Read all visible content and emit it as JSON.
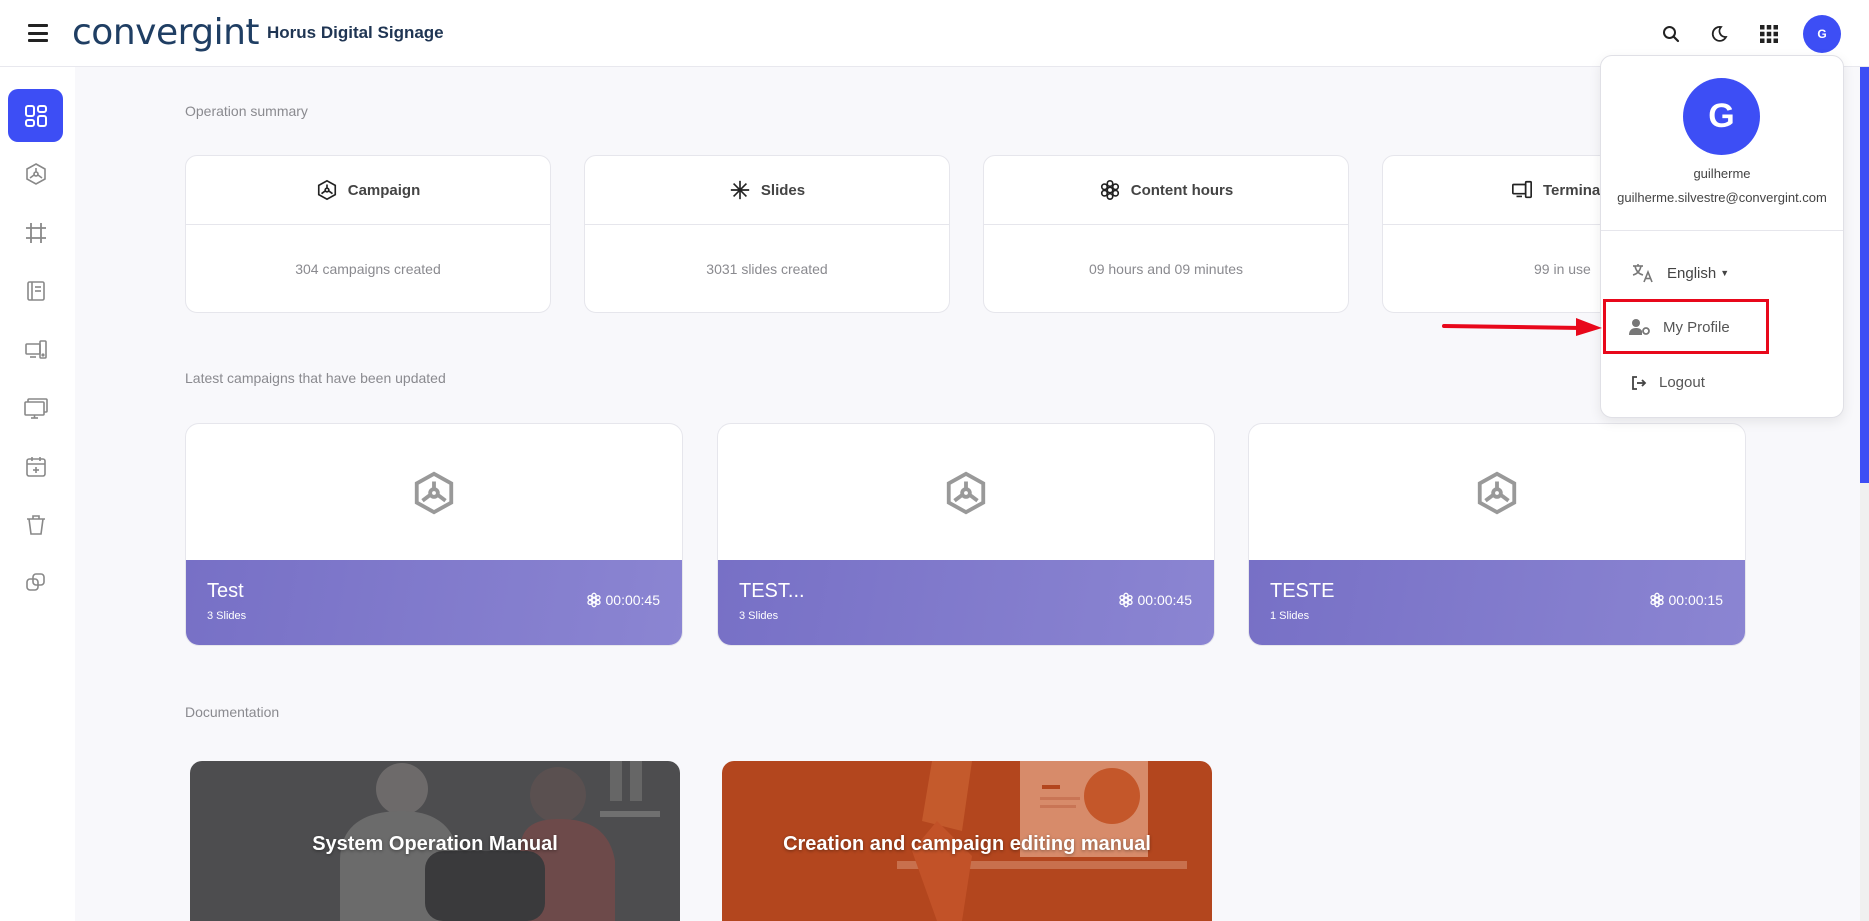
{
  "header": {
    "logo_text": "convergint",
    "app_title": "Horus Digital Signage",
    "avatar_initial": "G"
  },
  "sections": {
    "summary": "Operation summary",
    "latest": "Latest campaigns that have been updated",
    "docs": "Documentation"
  },
  "stats": [
    {
      "label": "Campaign",
      "value": "304 campaigns created",
      "icon": "campaign-icon"
    },
    {
      "label": "Slides",
      "value": "3031 slides created",
      "icon": "slides-icon"
    },
    {
      "label": "Content hours",
      "value": "09 hours and 09 minutes",
      "icon": "content-hours-icon"
    },
    {
      "label": "Termina",
      "value": "99 in use",
      "icon": "terminal-icon"
    }
  ],
  "campaigns": [
    {
      "name": "Test",
      "slides": "3 Slides",
      "duration": "00:00:45"
    },
    {
      "name": "TEST...",
      "slides": "3 Slides",
      "duration": "00:00:45"
    },
    {
      "name": "TESTE",
      "slides": "1 Slides",
      "duration": "00:00:15"
    }
  ],
  "docs": [
    {
      "title": "System Operation Manual"
    },
    {
      "title": "Creation and campaign editing manual"
    }
  ],
  "dropdown": {
    "avatar_initial": "G",
    "username": "guilherme",
    "email": "guilherme.silvestre@convergint.com",
    "language": "English",
    "my_profile": "My Profile",
    "logout": "Logout"
  },
  "colors": {
    "accent": "#3d4ef5",
    "campaign_band": "#7d77cb",
    "highlight": "#e8081b"
  }
}
